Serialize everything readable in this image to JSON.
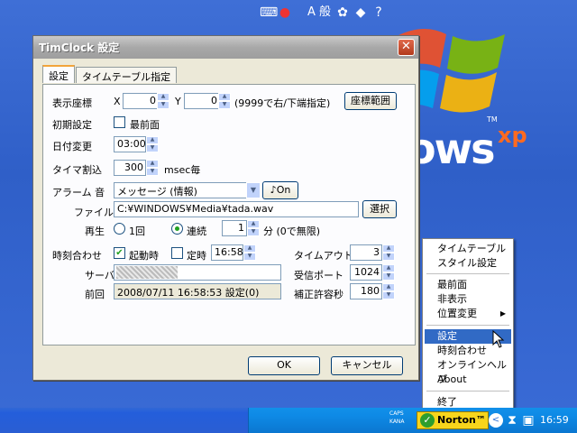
{
  "desktop": {
    "brand_text": "ows",
    "brand_sup": "xp",
    "brand_tm": "TM"
  },
  "dialog": {
    "title": "TimClock 設定",
    "close_glyph": "✕",
    "tabs": [
      "設定",
      "タイムテーブル指定"
    ],
    "position": {
      "label": "表示座標",
      "x_label": "X",
      "x_value": "0",
      "y_label": "Y",
      "y_value": "0",
      "hint": "(9999で右/下端指定)",
      "range_button": "座標範囲"
    },
    "initial": {
      "label": "初期設定",
      "topmost_label": "最前面",
      "topmost_checked": false
    },
    "date_change": {
      "label": "日付変更",
      "value": "03:00"
    },
    "timer_interrupt": {
      "label": "タイマ割込",
      "value": "300",
      "unit": "msec毎"
    },
    "alarm": {
      "label": "アラーム 音",
      "sound": "メッセージ (情報)",
      "on_button": "♪On",
      "file_label": "ファイル",
      "file_value": "C:¥WINDOWS¥Media¥tada.wav",
      "browse_button": "選択",
      "play_label": "再生",
      "once_label": "1回",
      "continuous_label": "連続",
      "repeat_value": "1",
      "repeat_unit": "分 (0で無限)"
    },
    "time_sync": {
      "label": "時刻合わせ",
      "on_startup_label": "起動時",
      "on_startup_checked": true,
      "scheduled_label": "定時",
      "scheduled_checked": false,
      "scheduled_time": "16:58",
      "server_label": "サーバ",
      "last_label": "前回",
      "last_value": "2008/07/11 16:58:53 設定(0)",
      "timeout_label": "タイムアウト秒",
      "timeout_value": "3",
      "port_label": "受信ポート",
      "port_value": "1024",
      "tolerance_label": "補正許容秒",
      "tolerance_value": "180"
    },
    "ok_button": "OK",
    "cancel_button": "キャンセル"
  },
  "context_menu": {
    "items": [
      "タイムテーブル",
      "スタイル設定",
      "最前面",
      "非表示",
      "位置変更",
      "設定",
      "時刻合わせ",
      "オンラインヘルプ",
      "About",
      "終了"
    ],
    "selected": "設定"
  },
  "taskbar": {
    "ime_text": "A 般",
    "caps_text": "CAPS",
    "kana_text": "KANA",
    "norton_label": "Norton™",
    "clock": "16:59"
  }
}
